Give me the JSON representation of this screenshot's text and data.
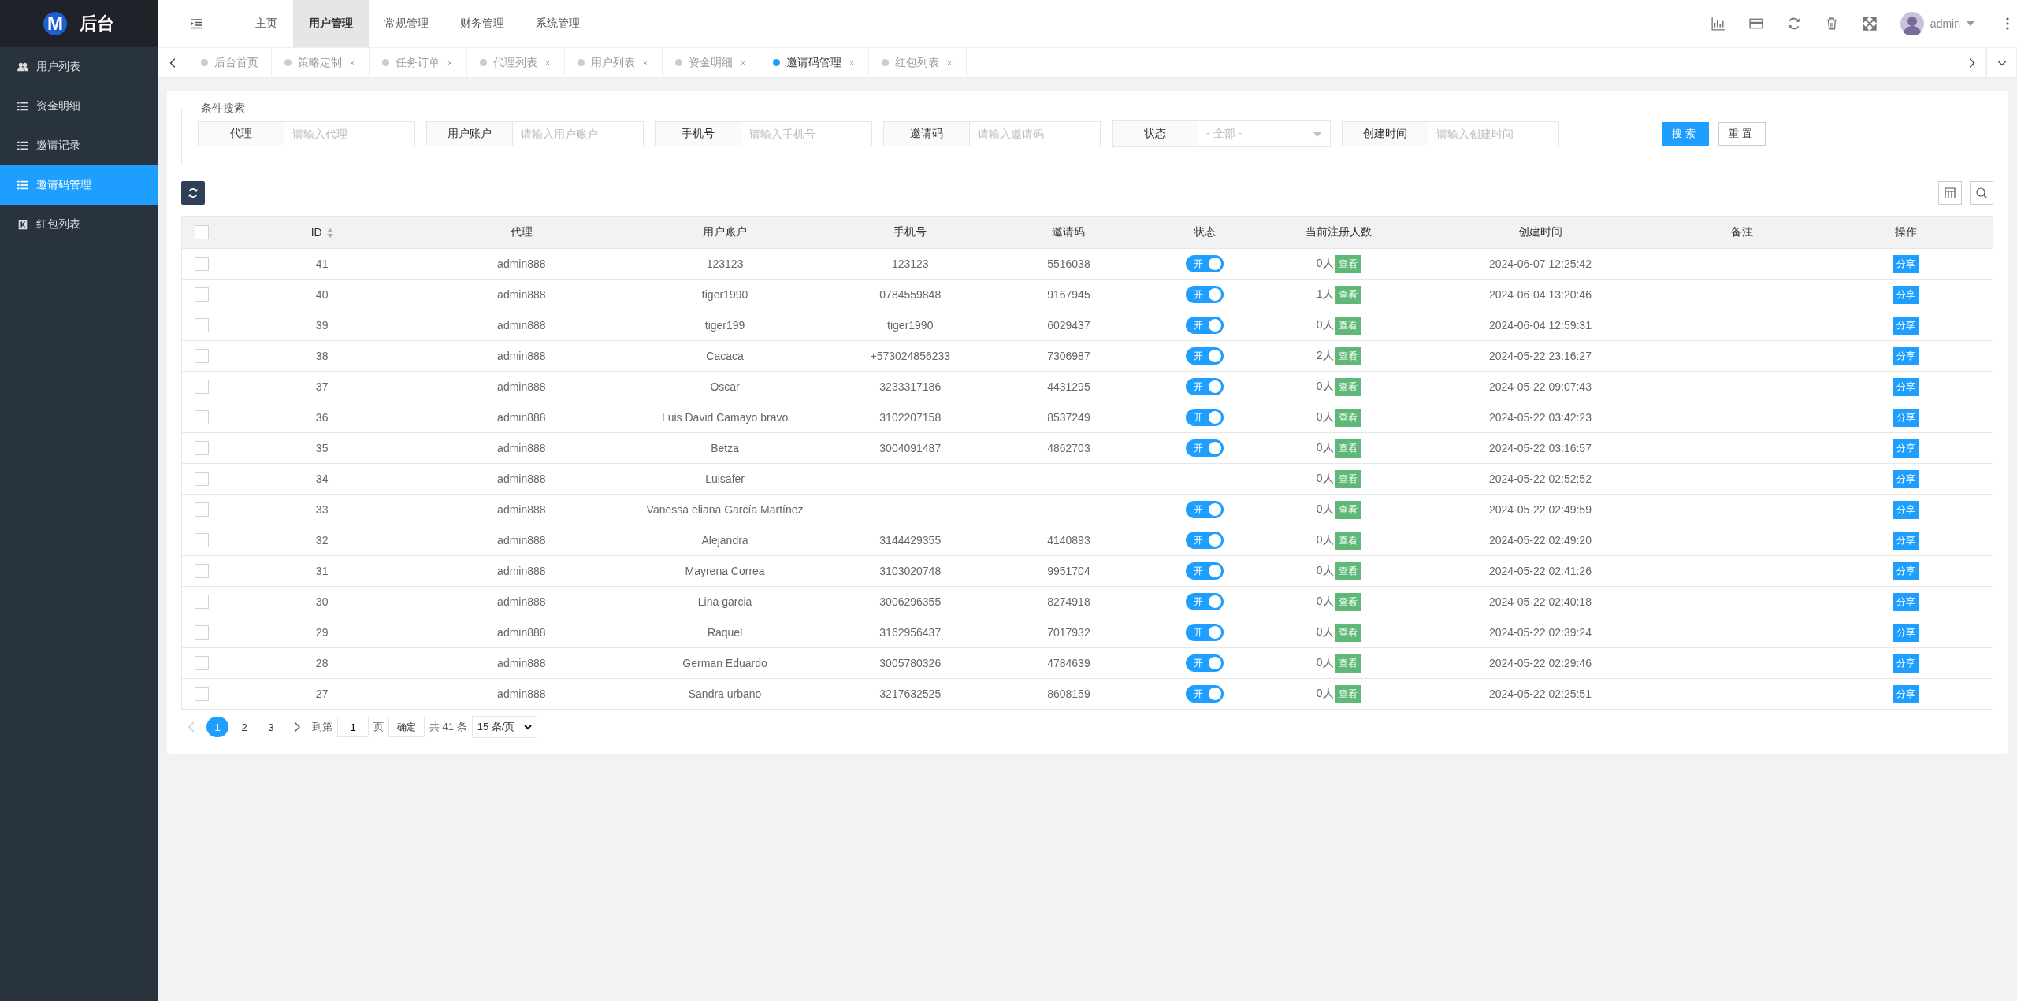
{
  "logo": {
    "title": "后台",
    "mark": "M"
  },
  "sidebar": {
    "items": [
      {
        "label": "用户列表",
        "selected": false
      },
      {
        "label": "资金明细",
        "selected": false
      },
      {
        "label": "邀请记录",
        "selected": false
      },
      {
        "label": "邀请码管理",
        "selected": true
      },
      {
        "label": "红包列表",
        "selected": false
      }
    ]
  },
  "top_menu": [
    {
      "label": "主页",
      "selected": false
    },
    {
      "label": "用户管理",
      "selected": true
    },
    {
      "label": "常规管理",
      "selected": false
    },
    {
      "label": "财务管理",
      "selected": false
    },
    {
      "label": "系统管理",
      "selected": false
    }
  ],
  "user": {
    "name": "admin"
  },
  "tabs": [
    {
      "label": "后台首页",
      "selected": false,
      "closable": false
    },
    {
      "label": "策略定制",
      "selected": false,
      "closable": true
    },
    {
      "label": "任务订单",
      "selected": false,
      "closable": true
    },
    {
      "label": "代理列表",
      "selected": false,
      "closable": true
    },
    {
      "label": "用户列表",
      "selected": false,
      "closable": true
    },
    {
      "label": "资金明细",
      "selected": false,
      "closable": true
    },
    {
      "label": "邀请码管理",
      "selected": true,
      "closable": true
    },
    {
      "label": "红包列表",
      "selected": false,
      "closable": true
    }
  ],
  "search": {
    "legend": "条件搜索",
    "fields": [
      {
        "kind": "input",
        "label": "代理",
        "placeholder": "请输入代理"
      },
      {
        "kind": "input",
        "label": "用户账户",
        "placeholder": "请输入用户账户"
      },
      {
        "kind": "input",
        "label": "手机号",
        "placeholder": "请输入手机号"
      },
      {
        "kind": "input",
        "label": "邀请码",
        "placeholder": "请输入邀请码"
      },
      {
        "kind": "select",
        "label": "状态",
        "placeholder": "- 全部 -"
      },
      {
        "kind": "input",
        "label": "创建时间",
        "placeholder": "请输入创建时间"
      }
    ],
    "buttons": [
      {
        "label": "搜索",
        "kind": "primary"
      },
      {
        "label": "重置",
        "kind": "plain"
      }
    ]
  },
  "table": {
    "all_checked": false,
    "columns": [
      "ID",
      "代理",
      "用户账户",
      "手机号",
      "邀请码",
      "状态",
      "当前注册人数",
      "创建时间",
      "备注",
      "操作"
    ],
    "rows": [
      {
        "checked": false,
        "id": "41",
        "agent": "admin888",
        "account": "123123",
        "phone": "123123",
        "code": "5516038",
        "status": {
          "label": "开",
          "on": true
        },
        "count": "0人",
        "view": "查看",
        "created": "2024-06-07 12:25:42",
        "action": "分享"
      },
      {
        "checked": false,
        "id": "40",
        "agent": "admin888",
        "account": "tiger1990",
        "phone": "0784559848",
        "code": "9167945",
        "status": {
          "label": "开",
          "on": true
        },
        "count": "1人",
        "view": "查看",
        "created": "2024-06-04 13:20:46",
        "action": "分享"
      },
      {
        "checked": false,
        "id": "39",
        "agent": "admin888",
        "account": "tiger199",
        "phone": "tiger1990",
        "code": "6029437",
        "status": {
          "label": "开",
          "on": true
        },
        "count": "0人",
        "view": "查看",
        "created": "2024-06-04 12:59:31",
        "action": "分享"
      },
      {
        "checked": false,
        "id": "38",
        "agent": "admin888",
        "account": "Cacaca",
        "phone": "+573024856233",
        "code": "7306987",
        "status": {
          "label": "开",
          "on": true
        },
        "count": "2人",
        "view": "查看",
        "created": "2024-05-22 23:16:27",
        "action": "分享"
      },
      {
        "checked": false,
        "id": "37",
        "agent": "admin888",
        "account": "Oscar",
        "phone": "3233317186",
        "code": "4431295",
        "status": {
          "label": "开",
          "on": true
        },
        "count": "0人",
        "view": "查看",
        "created": "2024-05-22 09:07:43",
        "action": "分享"
      },
      {
        "checked": false,
        "id": "36",
        "agent": "admin888",
        "account": "Luis David Camayo bravo",
        "phone": "3102207158",
        "code": "8537249",
        "status": {
          "label": "开",
          "on": true
        },
        "count": "0人",
        "view": "查看",
        "created": "2024-05-22 03:42:23",
        "action": "分享"
      },
      {
        "checked": false,
        "id": "35",
        "agent": "admin888",
        "account": "Betza",
        "phone": "3004091487",
        "code": "4862703",
        "status": {
          "label": "开",
          "on": true
        },
        "count": "0人",
        "view": "查看",
        "created": "2024-05-22 03:16:57",
        "action": "分享"
      },
      {
        "checked": false,
        "id": "34",
        "agent": "admin888",
        "account": "Luisafer",
        "count": "0人",
        "view": "查看",
        "created": "2024-05-22 02:52:52",
        "action": "分享"
      },
      {
        "checked": false,
        "id": "33",
        "agent": "admin888",
        "account": "Vanessa eliana García Martínez",
        "status": {
          "label": "开",
          "on": true
        },
        "count": "0人",
        "view": "查看",
        "created": "2024-05-22 02:49:59",
        "action": "分享"
      },
      {
        "checked": false,
        "id": "32",
        "agent": "admin888",
        "account": "Alejandra",
        "phone": "3144429355",
        "code": "4140893",
        "status": {
          "label": "开",
          "on": true
        },
        "count": "0人",
        "view": "查看",
        "created": "2024-05-22 02:49:20",
        "action": "分享"
      },
      {
        "checked": false,
        "id": "31",
        "agent": "admin888",
        "account": "Mayrena Correa",
        "phone": "3103020748",
        "code": "9951704",
        "status": {
          "label": "开",
          "on": true
        },
        "count": "0人",
        "view": "查看",
        "created": "2024-05-22 02:41:26",
        "action": "分享"
      },
      {
        "checked": false,
        "id": "30",
        "agent": "admin888",
        "account": "Lina garcia",
        "phone": "3006296355",
        "code": "8274918",
        "status": {
          "label": "开",
          "on": true
        },
        "count": "0人",
        "view": "查看",
        "created": "2024-05-22 02:40:18",
        "action": "分享"
      },
      {
        "checked": false,
        "id": "29",
        "agent": "admin888",
        "account": "Raquel",
        "phone": "3162956437",
        "code": "7017932",
        "status": {
          "label": "开",
          "on": true
        },
        "count": "0人",
        "view": "查看",
        "created": "2024-05-22 02:39:24",
        "action": "分享"
      },
      {
        "checked": false,
        "id": "28",
        "agent": "admin888",
        "account": "German Eduardo",
        "phone": "3005780326",
        "code": "4784639",
        "status": {
          "label": "开",
          "on": true
        },
        "count": "0人",
        "view": "查看",
        "created": "2024-05-22 02:29:46",
        "action": "分享"
      },
      {
        "checked": false,
        "id": "27",
        "agent": "admin888",
        "account": "Sandra urbano",
        "phone": "3217632525",
        "code": "8608159",
        "status": {
          "label": "开",
          "on": true
        },
        "count": "0人",
        "view": "查看",
        "created": "2024-05-22 02:25:51",
        "action": "分享"
      }
    ]
  },
  "pagination": {
    "pages": [
      {
        "label": "1",
        "selected": true
      },
      {
        "label": "2",
        "selected": false
      },
      {
        "label": "3",
        "selected": false
      }
    ],
    "goto_label": "到第",
    "goto_value": "1",
    "page_unit": "页",
    "confirm": "确定",
    "total": "共 41 条",
    "page_size": "15 条/页"
  }
}
